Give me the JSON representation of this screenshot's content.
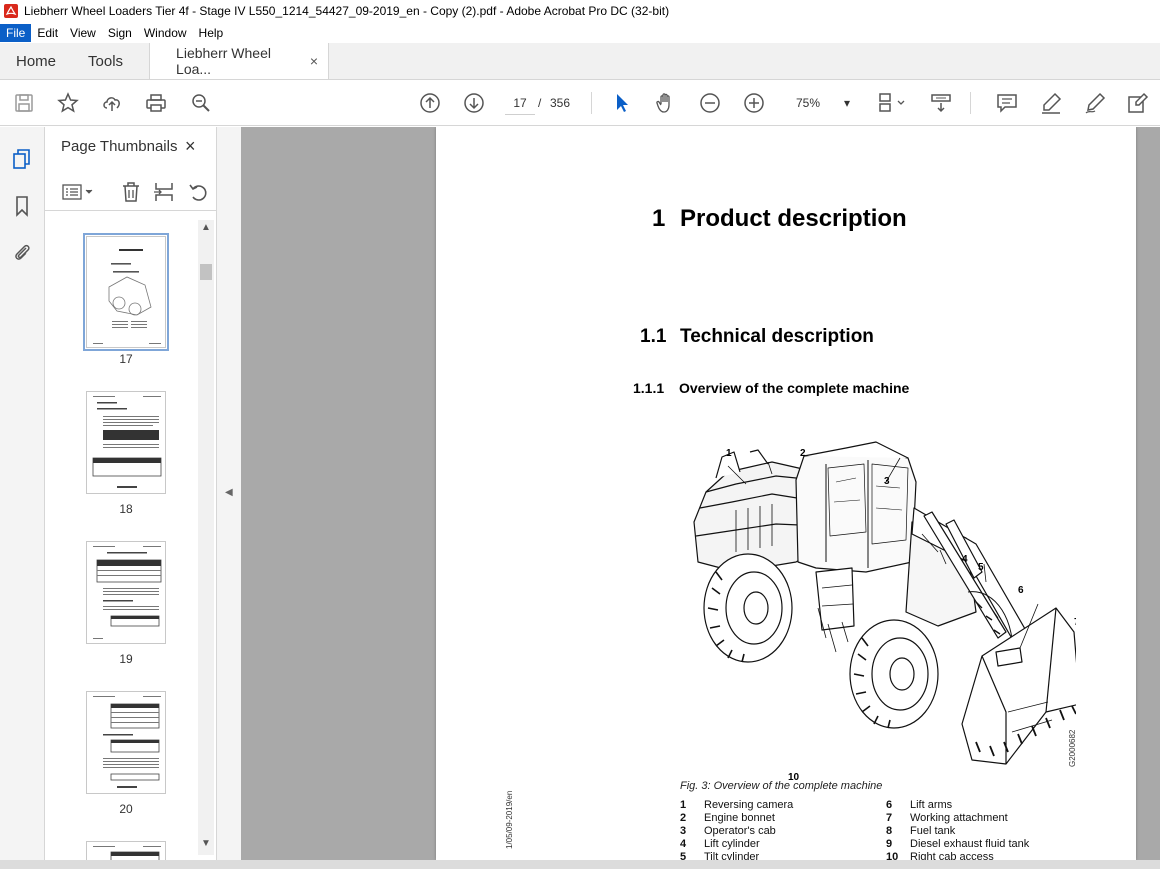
{
  "window": {
    "title": "Liebherr Wheel Loaders Tier 4f - Stage IV L550_1214_54427_09-2019_en - Copy (2).pdf - Adobe Acrobat Pro DC (32-bit)"
  },
  "menu": [
    "File",
    "Edit",
    "View",
    "Sign",
    "Window",
    "Help"
  ],
  "tabs": {
    "home": "Home",
    "tools": "Tools",
    "document": "Liebherr Wheel Loa...",
    "close": "×"
  },
  "toolbar": {
    "current_page": "17",
    "separator": "/",
    "total_pages": "356",
    "zoom": "75%",
    "zoom_arrow": "▾"
  },
  "thumbnails": {
    "title": "Page Thumbnails",
    "close": "×",
    "pages": [
      "17",
      "18",
      "19",
      "20"
    ]
  },
  "document": {
    "h1_num": "1",
    "h1_text": "Product description",
    "h2_num": "1.1",
    "h2_text": "Technical description",
    "h3_num": "1.1.1",
    "h3_text": "Overview of the complete machine",
    "caption": "Fig. 3: Overview of the complete machine",
    "callouts": [
      "1",
      "2",
      "3",
      "4",
      "5",
      "6",
      "7",
      "8",
      "9",
      "10"
    ],
    "figure_code": "G2000682",
    "side_code": "1/05/09-2019/en",
    "legend_left": [
      {
        "n": "1",
        "t": "Reversing camera"
      },
      {
        "n": "2",
        "t": "Engine bonnet"
      },
      {
        "n": "3",
        "t": "Operator's cab"
      },
      {
        "n": "4",
        "t": "Lift cylinder"
      },
      {
        "n": "5",
        "t": "Tilt cylinder"
      }
    ],
    "legend_right": [
      {
        "n": "6",
        "t": "Lift arms"
      },
      {
        "n": "7",
        "t": "Working attachment"
      },
      {
        "n": "8",
        "t": "Fuel tank"
      },
      {
        "n": "9",
        "t": "Diesel exhaust fluid tank"
      },
      {
        "n": "10",
        "t": "Right cab access"
      }
    ]
  },
  "colors": {
    "accent": "#0b5fc7",
    "doc_bg": "#a9a9a9",
    "app_icon": "#d9281b"
  }
}
